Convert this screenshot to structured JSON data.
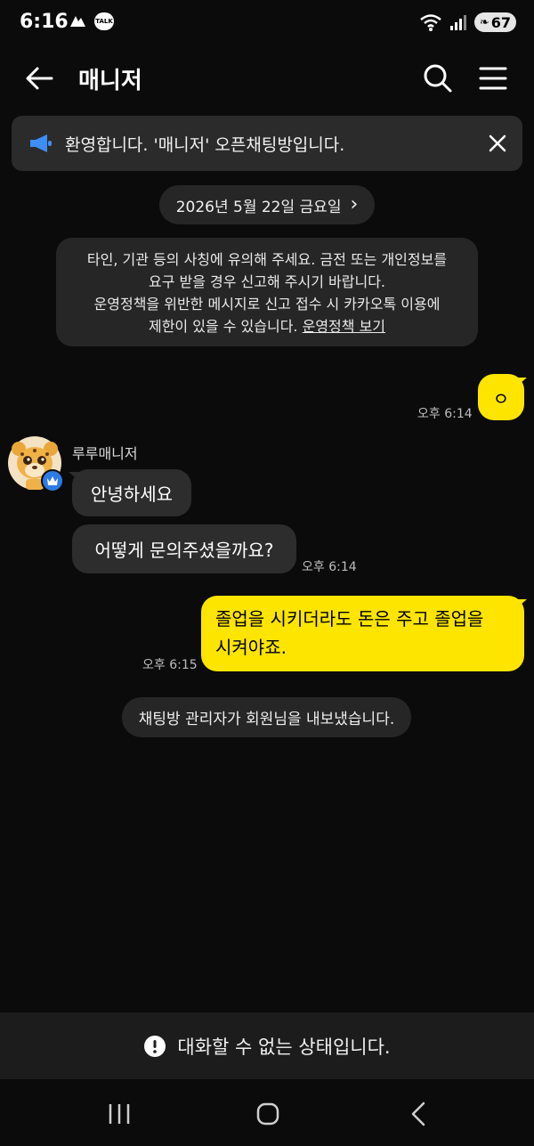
{
  "status_bar": {
    "time": "6:16",
    "talk_badge": "TALK",
    "battery": "67"
  },
  "header": {
    "title": "매니저"
  },
  "notice": {
    "text": "환영합니다. '매니저' 오픈채팅방입니다."
  },
  "date_divider": {
    "label": "2026년 5월 22일 금요일",
    "chevron": "›"
  },
  "policy_notice": {
    "line1": "타인, 기관 등의 사칭에 유의해 주세요. 금전 또는 개인정보를",
    "line2": "요구 받을 경우 신고해 주시기 바랍니다.",
    "line3": "운영정책을 위반한 메시지로 신고 접수 시 카카오톡 이용에",
    "line4": "제한이 있을 수 있습니다.",
    "link": "운영정책 보기"
  },
  "messages": [
    {
      "from": "me",
      "text": "ㅇ",
      "time": "오후 6:14"
    },
    {
      "from": "manager",
      "sender": "루루매니저",
      "text": "안녕하세요"
    },
    {
      "from": "manager",
      "text": "어떻게 문의주셨을까요?",
      "time": "오후 6:14"
    },
    {
      "from": "me",
      "line1": "졸업을 시키더라도 돈은 주고 졸업을",
      "line2": "시켜야죠.",
      "time": "오후 6:15"
    }
  ],
  "system_message": "채팅방 관리자가 회원님을 내보냈습니다.",
  "bottom_status": "대화할 수 없는 상태입니다.",
  "colors": {
    "background": "#0b0b0b",
    "my_bubble": "#fee500",
    "other_bubble": "#2d2d2d",
    "notice_icon": "#3d8ef7",
    "crown_badge": "#2d7be5"
  },
  "icons": [
    "back-arrow-icon",
    "search-icon",
    "menu-icon",
    "megaphone-icon",
    "close-icon",
    "crown-icon",
    "alert-icon",
    "recent-apps-icon",
    "home-icon",
    "back-nav-icon"
  ]
}
